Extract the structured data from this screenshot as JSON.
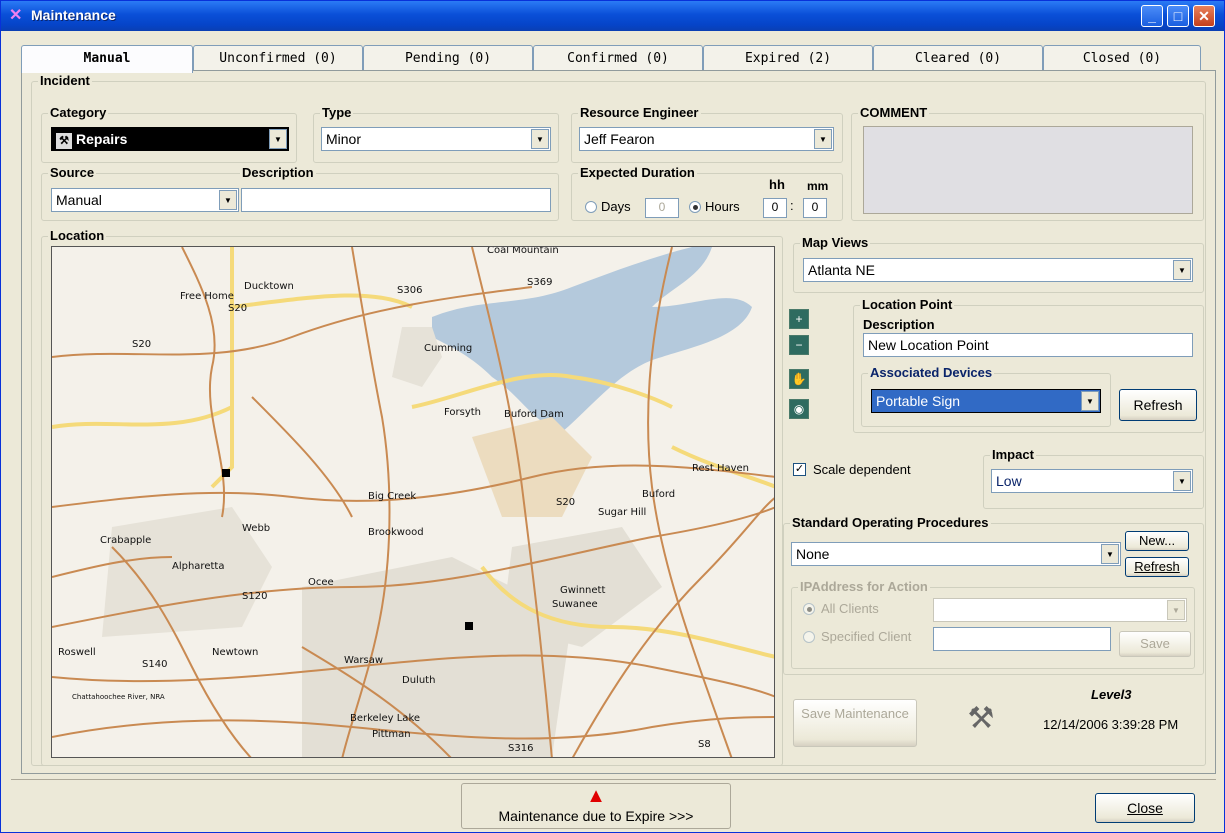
{
  "window": {
    "title": "Maintenance",
    "controls": [
      "minimize",
      "maximize",
      "close"
    ]
  },
  "tabs": [
    {
      "label": "Manual"
    },
    {
      "label": "Unconfirmed (0)"
    },
    {
      "label": "Pending (0)"
    },
    {
      "label": "Confirmed (0)"
    },
    {
      "label": "Expired (2)"
    },
    {
      "label": "Cleared (0)"
    },
    {
      "label": "Closed (0)"
    }
  ],
  "incident": {
    "group_label": "Incident",
    "category": {
      "label": "Category",
      "value": "Repairs"
    },
    "type": {
      "label": "Type",
      "value": "Minor"
    },
    "resource_engineer": {
      "label": "Resource Engineer",
      "value": "Jeff Fearon"
    },
    "comment": {
      "label": "COMMENT",
      "value": ""
    },
    "source": {
      "label": "Source",
      "value": "Manual"
    },
    "description": {
      "label": "Description",
      "value": ""
    },
    "expected_duration": {
      "label": "Expected Duration",
      "days_label": "Days",
      "days_value": "0",
      "hours_label": "Hours",
      "hh_label": "hh",
      "mm_label": "mm",
      "hh_value": "0",
      "mm_value": "0",
      "selected": "Hours"
    }
  },
  "location": {
    "label": "Location",
    "map_labels": [
      "Coal Mountain",
      "Free Home",
      "Ducktown",
      "S20",
      "S306",
      "S369",
      "Cumming",
      "S20",
      "Forsyth",
      "Buford Dam",
      "Rest Haven",
      "Big Creek",
      "Buford",
      "S20",
      "Sugar Hill",
      "Webb",
      "Brookwood",
      "Crabapple",
      "Alpharetta",
      "Ocee",
      "S120",
      "Gwinnett",
      "Suwanee",
      "Roswell",
      "Newtown",
      "S140",
      "Warsaw",
      "Duluth",
      "Chattahoochee River, NRA",
      "Berkeley Lake",
      "Pittman",
      "S316",
      "S8"
    ]
  },
  "map_controls": [
    "zoom-in",
    "zoom-out",
    "pan",
    "full-extent"
  ],
  "map_views": {
    "label": "Map Views",
    "value": "Atlanta NE"
  },
  "location_point": {
    "label": "Location Point",
    "description_label": "Description",
    "description_value": "New Location Point",
    "associated_devices_label": "Associated Devices",
    "associated_devices_value": "Portable Sign",
    "refresh_label": "Refresh"
  },
  "scale_dependent": {
    "label": "Scale dependent",
    "checked": true
  },
  "impact": {
    "label": "Impact",
    "value": "Low"
  },
  "sop": {
    "label": "Standard Operating Procedures",
    "value": "None",
    "new_label": "New...",
    "refresh_label": "Refresh"
  },
  "ip_address": {
    "label": "IPAddress for Action",
    "all_clients_label": "All Clients",
    "specified_client_label": "Specified Client",
    "save_label": "Save",
    "selected": "All Clients"
  },
  "save_maintenance_label": "Save Maintenance",
  "level_label": "Level3",
  "timestamp": "12/14/2006 3:39:28 PM",
  "maintenance_due_label": "Maintenance due to Expire >>>",
  "close_label": "Close"
}
